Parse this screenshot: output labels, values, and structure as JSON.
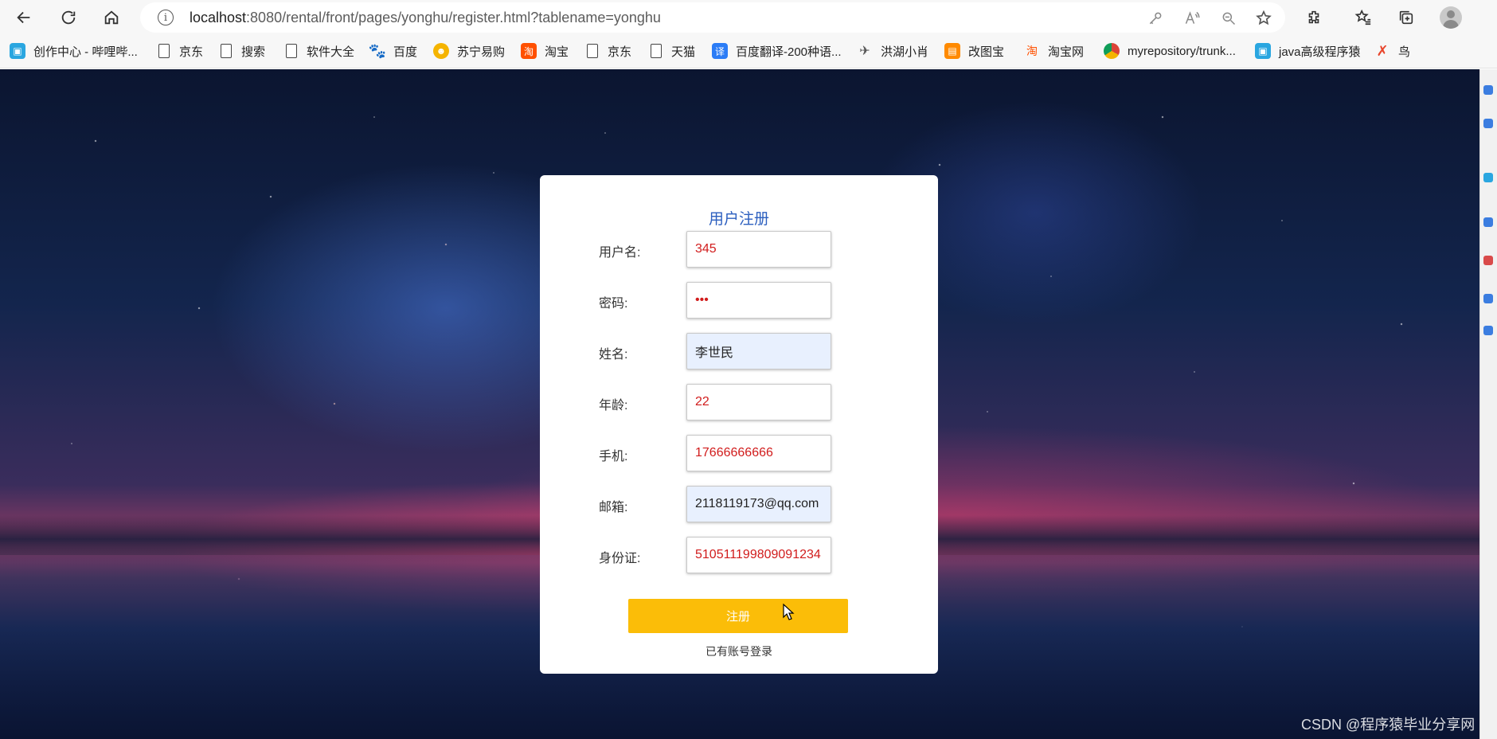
{
  "browser": {
    "url_host": "localhost",
    "url_rest": ":8080/rental/front/pages/yonghu/register.html?tablename=yonghu",
    "info_icon": "i"
  },
  "bookmarks": [
    {
      "label": "创作中心 - 哔哩哔...",
      "icon": "bilibili-icon",
      "color": "#2aa6e0"
    },
    {
      "label": "京东",
      "icon": "page-icon"
    },
    {
      "label": "搜索",
      "icon": "page-icon"
    },
    {
      "label": "软件大全",
      "icon": "page-icon"
    },
    {
      "label": "百度",
      "icon": "baidu-paw-icon",
      "color": "#2932e1"
    },
    {
      "label": "苏宁易购",
      "icon": "suning-icon",
      "color": "#f5b400"
    },
    {
      "label": "淘宝",
      "icon": "taobao-icon",
      "color": "#ff5000"
    },
    {
      "label": "京东",
      "icon": "page-icon"
    },
    {
      "label": "天猫",
      "icon": "page-icon"
    },
    {
      "label": "百度翻译-200种语...",
      "icon": "baidu-translate-icon",
      "color": "#2b7cf6"
    },
    {
      "label": "洪湖小肖",
      "icon": "bird-icon",
      "color": "#555555"
    },
    {
      "label": "改图宝",
      "icon": "gaitubao-icon",
      "color": "#ff8a00"
    },
    {
      "label": "淘宝网",
      "icon": "taobao-icon",
      "color": "#ff5000"
    },
    {
      "label": "myrepository/trunk...",
      "icon": "chrome-icon",
      "color": "#db4437"
    },
    {
      "label": "java高级程序猿",
      "icon": "bilibili-icon",
      "color": "#2aa6e0"
    },
    {
      "label": "鸟",
      "icon": "bird-red-icon",
      "color": "#e8452b"
    }
  ],
  "form": {
    "title": "用户注册",
    "fields": [
      {
        "label": "用户名:",
        "value": "345",
        "autofill": false
      },
      {
        "label": "密码:",
        "value": "•••",
        "autofill": false
      },
      {
        "label": "姓名:",
        "value": "李世民",
        "autofill": true
      },
      {
        "label": "年龄:",
        "value": "22",
        "autofill": false
      },
      {
        "label": "手机:",
        "value": "17666666666",
        "autofill": false
      },
      {
        "label": "邮箱:",
        "value": "2118119173@qq.com",
        "autofill": true
      },
      {
        "label": "身份证:",
        "value": "510511199809091234",
        "autofill": false
      }
    ],
    "submit_label": "注册",
    "login_link": "已有账号登录"
  },
  "colors": {
    "title": "#2c5fbf",
    "button": "#fbbd08",
    "input_text": "#d11c1c",
    "autofill_bg": "#e8f0fe"
  },
  "watermark": "CSDN @程序猿毕业分享网"
}
